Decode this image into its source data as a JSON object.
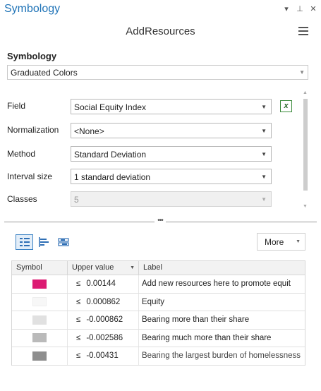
{
  "pane": {
    "title": "Symbology",
    "controls": [
      "▾",
      "⊥",
      "✕"
    ],
    "layer_name": "AddResources"
  },
  "symbology": {
    "section_label": "Symbology",
    "renderer": "Graduated Colors"
  },
  "fields": {
    "field": {
      "label": "Field",
      "value": "Social Equity Index"
    },
    "normalization": {
      "label": "Normalization",
      "value": "<None>"
    },
    "method": {
      "label": "Method",
      "value": "Standard Deviation"
    },
    "interval": {
      "label": "Interval size",
      "value": "1 standard deviation"
    },
    "classes": {
      "label": "Classes",
      "value": "5",
      "disabled": true
    }
  },
  "toolbar": {
    "more_label": "More",
    "views": [
      "classes-view-icon",
      "histogram-view-icon",
      "scales-view-icon"
    ]
  },
  "grid": {
    "columns": {
      "symbol": "Symbol",
      "upper": "Upper value",
      "label": "Label"
    },
    "rows": [
      {
        "color": "#dc1b73",
        "leq": "≤",
        "upper": "0.00144",
        "label": "Add new resources here to promote equit"
      },
      {
        "color": "#f7f7f7",
        "leq": "≤",
        "upper": "0.000862",
        "label": "Equity"
      },
      {
        "color": "#e1e1e1",
        "leq": "≤",
        "upper": "-0.000862",
        "label": "Bearing more than their share"
      },
      {
        "color": "#bababa",
        "leq": "≤",
        "upper": "-0.002586",
        "label": "Bearing much more than their share"
      },
      {
        "color": "#8e8e8e",
        "leq": "≤",
        "upper": "-0.00431",
        "label": "Bearing the largest burden of homelessness"
      }
    ]
  }
}
